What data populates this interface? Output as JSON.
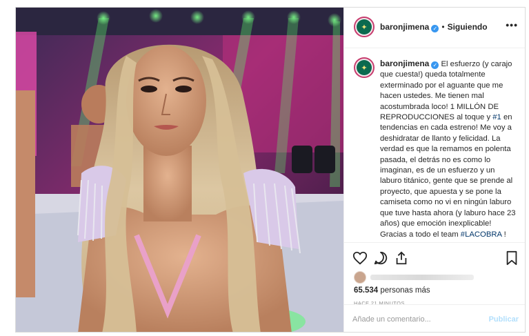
{
  "post": {
    "username": "baronjimena",
    "verified_mark": "✓",
    "separator": "•",
    "follow_status": "Siguiendo",
    "more_label": "•••",
    "avatar_glyph": "✦",
    "caption_parts": [
      "El esfuerzo (y carajo que cuesta!) queda totalmente exterminado por el aguante que me hacen ustedes. Me tienen mal acostumbrada loco! 1 MILLÓN DE REPRODUCCIONES al toque y ",
      "#1",
      " en tendencias en cada estreno! Me voy a deshidratar de llanto y felicidad. La verdad es que la remamos en polenta pasada, el detrás no es como lo imaginan, es de un esfuerzo y un laburo titánico, gente que se prende al proyecto, que apuesta y se pone la camiseta como no vi en ningún laburo que tuve hasta ahora (y laburo hace 23 años) que emoción inexplicable! Gracias a todo el team ",
      "#LACOBRA",
      " !"
    ],
    "likes_count": "65.534",
    "likes_suffix": " personas más",
    "time_ago": "HACE 21 MINUTOS",
    "comment_placeholder": "Añade un comentario...",
    "publish_label": "Publicar"
  },
  "icons": [
    "heart-icon",
    "comment-icon",
    "share-icon",
    "bookmark-icon"
  ],
  "colors": {
    "link": "#003569",
    "verified": "#3897f0",
    "publish": "#b2dffc",
    "ring": "#c73c6e"
  }
}
